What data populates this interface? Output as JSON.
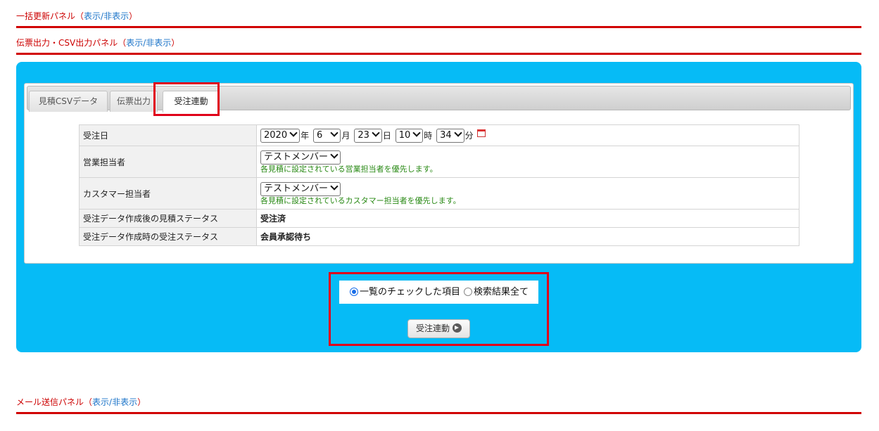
{
  "panels": {
    "bulk_update": {
      "title": "一括更新パネル",
      "toggle": "表示/非表示"
    },
    "slip_csv": {
      "title": "伝票出力・CSV出力パネル",
      "toggle": "表示/非表示"
    },
    "mail": {
      "title": "メール送信パネル",
      "toggle": "表示/非表示"
    }
  },
  "paren_open": "（",
  "paren_close": "）",
  "tabs": [
    {
      "label": "見積CSVデータ",
      "active": false
    },
    {
      "label": "伝票出力",
      "active": false
    },
    {
      "label": "受注連動",
      "active": true
    }
  ],
  "form": {
    "order_date": {
      "label": "受注日",
      "year": "2020",
      "year_unit": "年",
      "month": "6",
      "month_unit": "月",
      "day": "23",
      "day_unit": "日",
      "hour": "10",
      "hour_unit": "時",
      "minute": "34",
      "minute_unit": "分"
    },
    "sales_rep": {
      "label": "営業担当者",
      "value": "テストメンバー",
      "note": "各見積に設定されている営業担当者を優先します。"
    },
    "customer_rep": {
      "label": "カスタマー担当者",
      "value": "テストメンバー",
      "note": "各見積に設定されているカスタマー担当者を優先します。"
    },
    "estimate_status": {
      "label": "受注データ作成後の見積ステータス",
      "value": "受注済"
    },
    "order_status": {
      "label": "受注データ作成時の受注ステータス",
      "value": "会員承認待ち"
    }
  },
  "target": {
    "option_checked": "一覧のチェックした項目",
    "option_all": "検索結果全て",
    "selected": "option_checked"
  },
  "action_button": {
    "label": "受注連動"
  },
  "colors": {
    "accent_red": "#cc0000",
    "panel_blue": "#06bbf6",
    "link_blue": "#1a73c8",
    "note_green": "#2a8a16",
    "highlight_red": "#e0001a"
  }
}
